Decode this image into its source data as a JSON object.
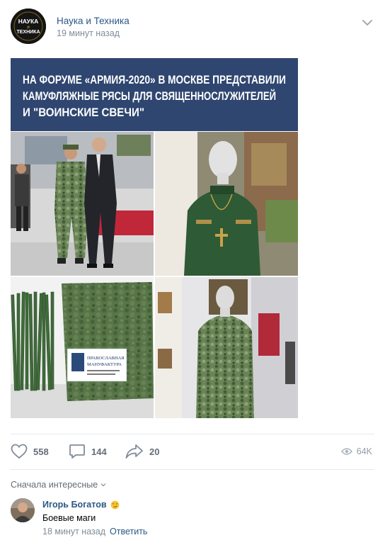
{
  "post": {
    "author": "Наука и Техника",
    "time": "19 минут назад",
    "avatar_text_top": "НАУКА",
    "avatar_text_mid": "и",
    "avatar_text_bottom": "ТЕХНИКА",
    "image": {
      "headline_lines": [
        "НА ФОРУМЕ «АРМИЯ-2020» В МОСКВЕ ПРЕДСТАВИЛИ",
        "КАМУФЛЯЖНЫЕ РЯСЫ ДЛЯ СВЯЩЕННОСЛУЖИТЕЛЕЙ",
        "И \"ВОИНСКИЕ СВЕЧИ\""
      ],
      "label_line1": "ПРАВОСЛАВНАЯ",
      "label_line2": "МАНУФАКТУРА"
    }
  },
  "actions": {
    "likes": "558",
    "comments": "144",
    "shares": "20",
    "views": "64K"
  },
  "comments_section": {
    "sort_label": "Сначала интересные",
    "items": [
      {
        "author": "Игорь Богатов",
        "text": "Боевые маги",
        "time": "18 минут назад",
        "reply_label": "Ответить"
      }
    ]
  },
  "colors": {
    "link": "#2a5885",
    "muted": "#818c99",
    "banner": "#2f4670",
    "divider": "#e7e8ec"
  }
}
